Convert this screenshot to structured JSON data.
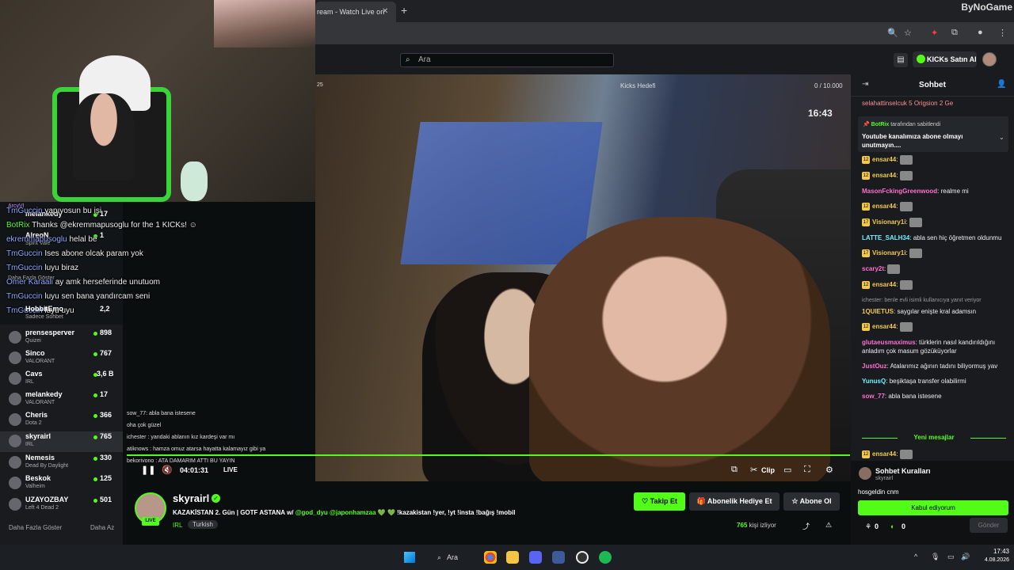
{
  "browser": {
    "tab_title": "ream - Watch Live on",
    "tab_close": "✕",
    "new_tab": "+",
    "watermark": "ByNoGame"
  },
  "header": {
    "search_placeholder": "Ara",
    "kicks_buy_label": "KICKs Satın Al"
  },
  "video": {
    "goal_label": "Kicks Hedefi",
    "goal_count": "0 / 10.000",
    "clock": "16:43",
    "corner_number": "25",
    "time": "04:01:31",
    "live_label": "LIVE",
    "clip_label": "Clip"
  },
  "overlay_chat": [
    {
      "user": "TmGuccin",
      "text": "yapıyosun bu işi"
    },
    {
      "user": "BotRix",
      "text": "Thanks @ekremmapusoglu for the 1 KICKs! ☺"
    },
    {
      "user": "ekremmapusoglu",
      "text": "helal be"
    },
    {
      "user": "TmGuccin",
      "text": "Ises abone olcak param yok"
    },
    {
      "user": "TmGuccin",
      "text": "luyu biraz"
    },
    {
      "user": "Ömer Karaali",
      "text": "ay amk herseferinde unutuom"
    },
    {
      "user": "TmGuccin",
      "text": "luyu sen bana yandırcam seni"
    },
    {
      "user": "TmGuccin",
      "text": "luyu uyu"
    }
  ],
  "overlay_side_top": [
    {
      "name": "melankedy",
      "cat": "",
      "count": "17"
    },
    {
      "name": "AlreoN",
      "cat": "Spirit Vale",
      "count": "1"
    }
  ],
  "overlay_side_small": [
    "ArcyVI",
    "Daha Fazla Göster",
    "Sadece Sohbet",
    "Quizei"
  ],
  "sidebar": {
    "items": [
      {
        "name": "HobbitEmo",
        "cat": "Sadece Sohbet",
        "count": "2,2"
      },
      {
        "name": "prensesperver",
        "cat": "Quizei",
        "count": "898"
      },
      {
        "name": "Sinco",
        "cat": "VALORANT",
        "count": "767"
      },
      {
        "name": "Cavs",
        "cat": "IRL",
        "count": "3,6 B"
      },
      {
        "name": "melankedy",
        "cat": "VALORANT",
        "count": "17"
      },
      {
        "name": "Cheris",
        "cat": "Dota 2",
        "count": "366"
      },
      {
        "name": "skyrairl",
        "cat": "IRL",
        "count": "765"
      },
      {
        "name": "Nemesis",
        "cat": "Dead By Daylight",
        "count": "330"
      },
      {
        "name": "Beskok",
        "cat": "Valheim",
        "count": "125"
      },
      {
        "name": "UZAYOZBAY",
        "cat": "Left 4 Dead 2",
        "count": "501"
      }
    ],
    "more": "Daha Fazla Göster",
    "less": "Daha Az"
  },
  "inchat": [
    "sow_77: abla bana istesene",
    "oha çok güzel",
    "ichester : yandaki ablanın kız kardeşi var mı",
    "atiknows : hamza omuz atarsa hayatta kalamayız gibi ya",
    "bekorivono : ATA DAMARIM ATTI BU YAYIN"
  ],
  "stream": {
    "name": "skyrairl",
    "live": "LIVE",
    "title_prefix": "KAZAKİSTAN 2. Gün | GOTF ASTANA w/",
    "title_tags": "@god_dyu @japonhamzaa",
    "title_suffix": "💚 💚 !kazakistan !yer, !yt !insta !bağış !mobil",
    "category": "IRL",
    "language": "Turkish",
    "follow_label": "Takip Et",
    "gift_label": "Abonelik Hediye Et",
    "sub_label": "Abone Ol",
    "viewers_count": "765",
    "viewers_label": "kişi izliyor"
  },
  "chat": {
    "title": "Sohbet",
    "gifters": "selahattinselcuk 5   Origsion 2   Ge",
    "pinned_by_user": "BotRix",
    "pinned_by_text": "tarafından sabitlendi",
    "pinned_msg": "Youtube kanalımıza abone olmayı unutmayın....",
    "messages": [
      {
        "badge": "12",
        "user": "ensar44",
        "color": "#f2c94c",
        "text": ""
      },
      {
        "badge": "12",
        "user": "ensar44",
        "color": "#f2c94c",
        "text": ""
      },
      {
        "badge": "",
        "user": "MasonFckingGreenwood",
        "color": "#ff6fcf",
        "text": "realme mi"
      },
      {
        "badge": "12",
        "user": "ensar44",
        "color": "#f2c94c",
        "text": ""
      },
      {
        "badge": "17",
        "user": "Visionary1i",
        "color": "#f2c94c",
        "text": ""
      },
      {
        "badge": "",
        "user": "LATTE_SALH34",
        "color": "#6ff2ff",
        "text": "abla sen hiç öğretmen oldunmu"
      },
      {
        "badge": "17",
        "user": "Visionary1i",
        "color": "#f2c94c",
        "text": ""
      },
      {
        "badge": "",
        "user": "scary2t",
        "color": "#ff6fcf",
        "text": ""
      },
      {
        "badge": "12",
        "user": "ensar44",
        "color": "#f2c94c",
        "text": ""
      },
      {
        "badge": "",
        "user": "1QUIETUS",
        "color": "#f2c94c",
        "text": "saygılar enişte kral adamsın"
      },
      {
        "badge": "12",
        "user": "ensar44",
        "color": "#f2c94c",
        "text": ""
      },
      {
        "badge": "",
        "user": "glutaeusmaximus",
        "color": "#ff6fcf",
        "text": "türklerin nasıl kandırıldığını anladım çok masum gözüküyorlar"
      },
      {
        "badge": "",
        "user": "JustOuz",
        "color": "#ff6fcf",
        "text": "Atalarımız ağının tadını biliyormuş yav"
      },
      {
        "badge": "",
        "user": "YunusQ",
        "color": "#6ff2ff",
        "text": "beşiktaşa transfer olabilirmi"
      },
      {
        "badge": "",
        "user": "sow_77",
        "color": "#ff6fcf",
        "text": "abla bana istesene"
      }
    ],
    "reply_note": "ichester: benle evli isimli kullanıcıya yanıt veriyor",
    "new_messages": "Yeni mesajlar",
    "last_user": "ensar44",
    "rules_title": "Sohbet Kuralları",
    "rules_user": "skyrairl",
    "rules_text": "hosgeldin cnm",
    "accept_label": "Kabul ediyorum",
    "kicks_count": "0",
    "points_count": "0",
    "send_label": "Gönder"
  },
  "taskbar": {
    "search_label": "Ara",
    "time": "17:43",
    "date": "4.08.2026"
  }
}
